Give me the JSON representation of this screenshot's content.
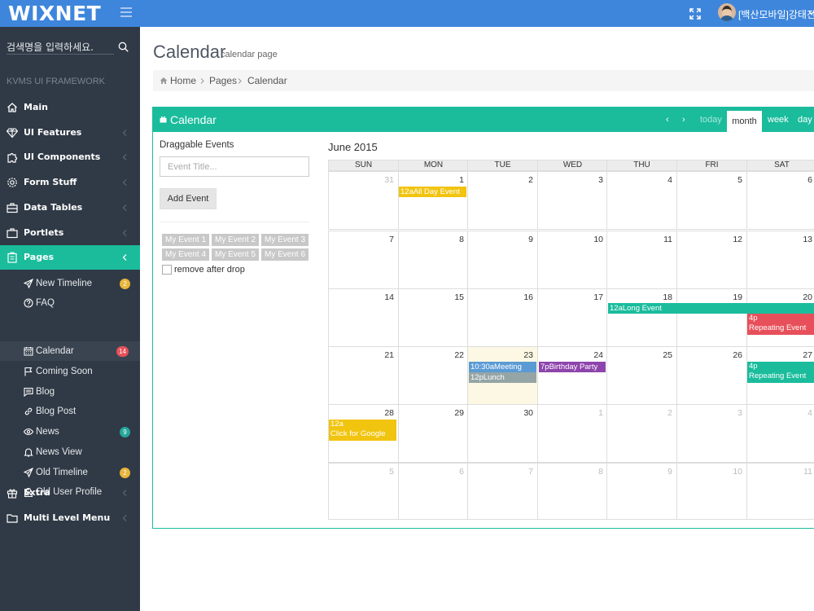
{
  "topbar": {
    "brand": "WIXNET",
    "username": "[백산모바일]강태진"
  },
  "sidebar": {
    "search_placeholder": "검색명을 입력하세요.",
    "framework_label": "KVMS UI FRAMEWORK",
    "main_items": [
      {
        "label": "Main",
        "icon": "home-icon"
      },
      {
        "label": "UI Features",
        "icon": "diamond-icon"
      },
      {
        "label": "UI Components",
        "icon": "puzzle-icon"
      },
      {
        "label": "Form Stuff",
        "icon": "settings-icon"
      },
      {
        "label": "Data Tables",
        "icon": "briefcase-icon"
      },
      {
        "label": "Portlets",
        "icon": "briefcase-icon"
      },
      {
        "label": "Pages",
        "icon": "clipboard-icon"
      },
      {
        "label": "Extra",
        "icon": "gift-icon"
      },
      {
        "label": "Multi Level Menu",
        "icon": "folder-icon"
      }
    ],
    "sub_items": [
      {
        "label": "New Timeline",
        "icon": "paper-plane-icon",
        "badge": "2",
        "badge_color": "#e7b53b"
      },
      {
        "label": "FAQ",
        "icon": "question-icon",
        "badge": "",
        "badge_color": ""
      },
      {
        "label": "Calendar",
        "icon": "calendar-icon",
        "badge": "14",
        "badge_color": "#e7505a"
      },
      {
        "label": "Coming Soon",
        "icon": "flag-icon",
        "badge": "",
        "badge_color": ""
      },
      {
        "label": "Blog",
        "icon": "speech-icon",
        "badge": "",
        "badge_color": ""
      },
      {
        "label": "Blog Post",
        "icon": "link-icon",
        "badge": "",
        "badge_color": ""
      },
      {
        "label": "News",
        "icon": "eye-icon",
        "badge": "9",
        "badge_color": "#26a69a"
      },
      {
        "label": "News View",
        "icon": "bell-icon",
        "badge": "",
        "badge_color": ""
      },
      {
        "label": "Old Timeline",
        "icon": "paper-plane-icon",
        "badge": "2",
        "badge_color": "#e7b53b"
      },
      {
        "label": "Old User Profile",
        "icon": "user-icon",
        "badge": "",
        "badge_color": ""
      }
    ]
  },
  "page": {
    "title": "Calendar",
    "subtitle": "calendar page"
  },
  "breadcrumb": [
    "Home",
    "Pages",
    "Calendar"
  ],
  "portlet": {
    "title": "Calendar"
  },
  "calendar_nav": {
    "prev": "‹",
    "next": "›",
    "today": "today",
    "month": "month",
    "week": "week",
    "day": "day"
  },
  "draggable": {
    "title": "Draggable Events",
    "input_placeholder": "Event Title...",
    "add_button": "Add Event",
    "events": [
      "My Event 1",
      "My Event 2",
      "My Event 3",
      "My Event 4",
      "My Event 5",
      "My Event 6"
    ],
    "remove_label": "remove after drop"
  },
  "calendar": {
    "title": "June 2015",
    "weekdays": [
      "SUN",
      "MON",
      "TUE",
      "WED",
      "THU",
      "FRI",
      "SAT"
    ],
    "weeks": [
      [
        31,
        1,
        2,
        3,
        4,
        5,
        6
      ],
      [
        7,
        8,
        9,
        10,
        11,
        12,
        13
      ],
      [
        14,
        15,
        16,
        17,
        18,
        19,
        20
      ],
      [
        21,
        22,
        23,
        24,
        25,
        26,
        27
      ],
      [
        28,
        29,
        30,
        1,
        2,
        3,
        4
      ],
      [
        5,
        6,
        7,
        8,
        9,
        10,
        11
      ]
    ],
    "today": "23",
    "events": [
      {
        "text": "12aAll Day Event",
        "color": "#f1c40f"
      },
      {
        "text": "12aLong Event",
        "color": "#1abc9c"
      },
      {
        "text": "4p",
        "text2": "Repeating Event",
        "color": "#e7505a"
      },
      {
        "text": "10:30aMeeting",
        "color": "#5b9bd5"
      },
      {
        "text": "12pLunch",
        "color": "#95a5a6"
      },
      {
        "text": "7pBirthday Party",
        "color": "#8e44ad"
      },
      {
        "text": "4p",
        "text2": "Repeating Event",
        "color": "#1abc9c"
      },
      {
        "text": "12a",
        "text2": "Click for Google",
        "color": "#f1c40f"
      }
    ]
  }
}
